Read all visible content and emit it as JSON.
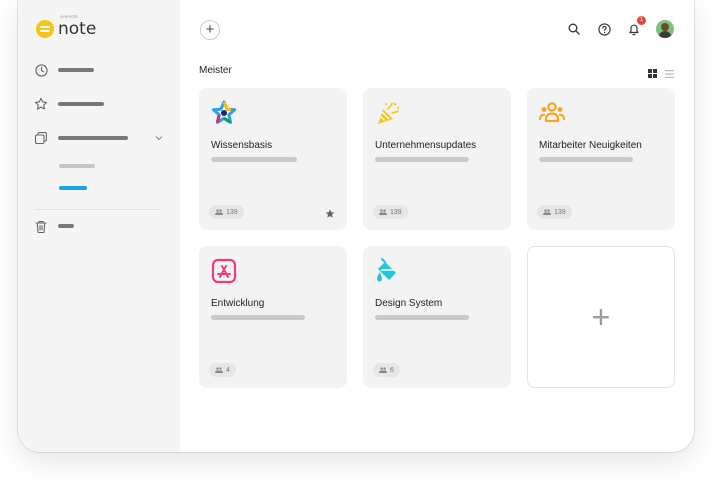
{
  "app": {
    "name": "note",
    "brand_tiny": "evernote",
    "accent": "#f5c518"
  },
  "header": {
    "add_label": "+",
    "notifications_count": "1"
  },
  "section": {
    "title": "Meister"
  },
  "cards": [
    {
      "title": "Wissensbasis",
      "members": "139",
      "icon": "star-icon"
    },
    {
      "title": "Unternehmensupdates",
      "members": "139",
      "icon": "party-popper-icon"
    },
    {
      "title": "Mitarbeiter Neuigkeiten",
      "members": "139",
      "icon": "people-icon"
    },
    {
      "title": "Entwicklung",
      "members": "4",
      "icon": "app-store-icon"
    },
    {
      "title": "Design System",
      "members": "6",
      "icon": "paint-bucket-icon"
    }
  ],
  "new_card": {
    "label": "+"
  }
}
